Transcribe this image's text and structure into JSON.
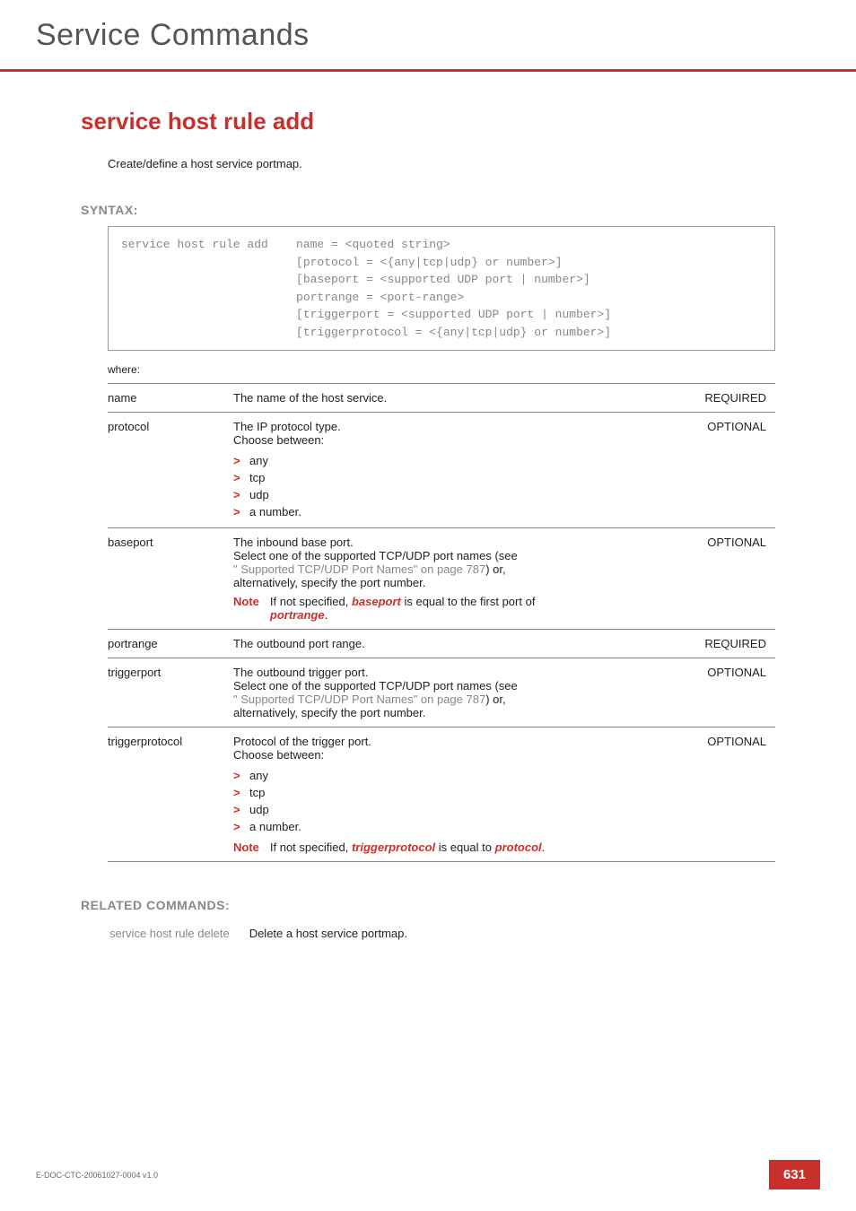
{
  "header": {
    "title": "Service Commands"
  },
  "command": {
    "title": "service host rule add",
    "intro": "Create/define a host service portmap."
  },
  "syntax": {
    "label": "SYNTAX:",
    "text": "service host rule add    name = <quoted string>\n                         [protocol = <{any|tcp|udp} or number>]\n                         [baseport = <supported UDP port | number>]\n                         portrange = <port-range>\n                         [triggerport = <supported UDP port | number>]\n                         [triggerprotocol = <{any|tcp|udp} or number>]"
  },
  "where_label": "where:",
  "params": [
    {
      "name": "name",
      "desc_plain": "The name of the host service.",
      "req": "REQUIRED"
    },
    {
      "name": "protocol",
      "desc_lead": "The IP protocol type.",
      "desc_sub": "Choose between:",
      "bullets": [
        "any",
        "tcp",
        "udp",
        "a number."
      ],
      "req": "OPTIONAL"
    },
    {
      "name": "baseport",
      "desc_lead": "The inbound base port.",
      "desc_line2": "Select one of the supported TCP/UDP port names (see",
      "desc_link": "\" Supported TCP/UDP Port Names\" on page 787",
      "desc_line2_tail": ") or,",
      "desc_line3": "alternatively, specify the port number.",
      "note_prefix": "Note",
      "note_text_a": "If not specified, ",
      "note_em1": "baseport",
      "note_text_b": " is equal to the first port of ",
      "note_em2": "portrange",
      "note_text_c": ".",
      "req": "OPTIONAL"
    },
    {
      "name": "portrange",
      "desc_plain": "The outbound port range.",
      "req": "REQUIRED"
    },
    {
      "name": "triggerport",
      "desc_lead": "The outbound trigger port.",
      "desc_line2": "Select one of the supported TCP/UDP port names (see",
      "desc_link": "\" Supported TCP/UDP Port Names\" on page 787",
      "desc_line2_tail": ") or,",
      "desc_line3": "alternatively, specify the port number.",
      "req": "OPTIONAL"
    },
    {
      "name": "triggerprotocol",
      "desc_lead": "Protocol of the trigger port.",
      "desc_sub": "Choose between:",
      "bullets": [
        "any",
        "tcp",
        "udp",
        "a number."
      ],
      "note_prefix": "Note",
      "note_text_a": "If not specified, ",
      "note_em1": "triggerprotocol",
      "note_text_b": " is equal to ",
      "note_em2": "protocol",
      "note_text_c": ".",
      "req": "OPTIONAL"
    }
  ],
  "related": {
    "label": "RELATED COMMANDS:",
    "rows": [
      {
        "cmd": "service host rule delete",
        "desc": "Delete a host service portmap."
      }
    ]
  },
  "footer": {
    "doc_id": "E-DOC-CTC-20061027-0004 v1.0",
    "page": "631"
  }
}
